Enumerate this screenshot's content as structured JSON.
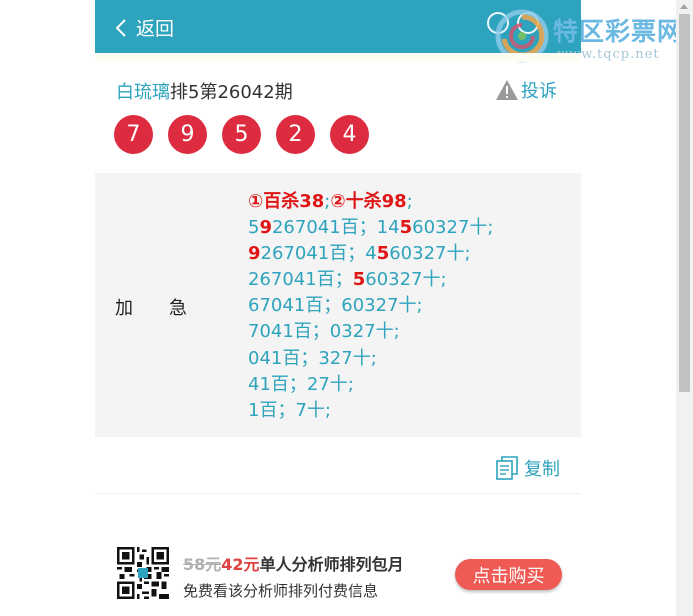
{
  "header": {
    "back_label": "返回",
    "back_icon": "chevron-left-icon",
    "background_color": "#2ea3bd"
  },
  "watermark": {
    "name": "特区彩票网",
    "url": "www.tqcp.net"
  },
  "article": {
    "author": "白琉璃",
    "title_suffix": "排5第26042期",
    "complain_label": "投诉",
    "complain_icon": "warning-triangle-icon"
  },
  "numbers": [
    "7",
    "9",
    "5",
    "2",
    "4"
  ],
  "ball_color": "#dd2b3f",
  "panel": {
    "label": "加　　急",
    "kill_hundred": "①百杀38",
    "kill_ten": "②十杀98",
    "lines": [
      {
        "a": "5",
        "b": "9",
        "c": "267041百；14",
        "d": "5",
        "e": "60327十;"
      },
      {
        "a": "",
        "b": "9",
        "c": "267041百；4",
        "d": "5",
        "e": "60327十;"
      },
      {
        "a": "",
        "b": "",
        "c": "267041百；",
        "d": "5",
        "e": "60327十;"
      },
      {
        "a": "",
        "b": "",
        "c": "67041百；60327十;",
        "d": "",
        "e": ""
      },
      {
        "a": "",
        "b": "",
        "c": "7041百；0327十;",
        "d": "",
        "e": ""
      },
      {
        "a": "",
        "b": "",
        "c": "041百；327十;",
        "d": "",
        "e": ""
      },
      {
        "a": "",
        "b": "",
        "c": "41百；27十;",
        "d": "",
        "e": ""
      },
      {
        "a": "",
        "b": "",
        "c": "1百；7十;",
        "d": "",
        "e": ""
      }
    ],
    "highlight_color": "#e01515"
  },
  "copy_label": "复制",
  "copy_icon": "copy-document-icon",
  "promo": {
    "old_price": "58元",
    "new_price": "42元",
    "title": "单人分析师排列包月",
    "description": "免费看该分析师排列付费信息",
    "button_label": "点击购买",
    "qr_icon": "qr-code-icon",
    "button_color": "#ef5b54"
  }
}
